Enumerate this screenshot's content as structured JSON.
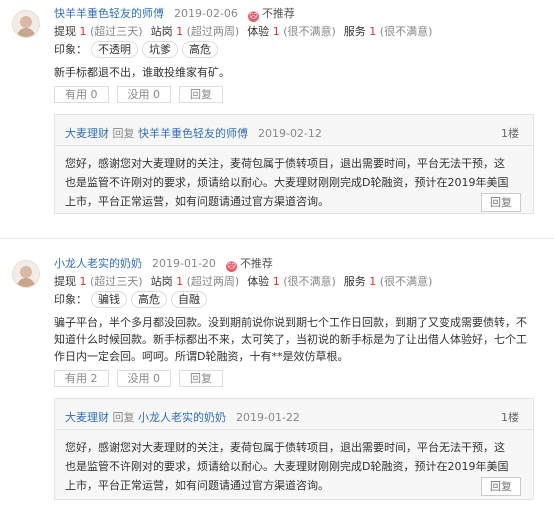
{
  "reviews": [
    {
      "username": "快羊羊重色轻友的师傅",
      "date": "2019-02-06",
      "recommend": "不推荐",
      "rec_icon": "☹",
      "ratings": [
        {
          "label": "提现",
          "value": "1",
          "note": "(超过三天)"
        },
        {
          "label": "站岗",
          "value": "1",
          "note": "(超过两周)"
        },
        {
          "label": "体验",
          "value": "1",
          "note": "(很不满意)"
        },
        {
          "label": "服务",
          "value": "1",
          "note": "(很不满意)"
        }
      ],
      "impression_label": "印象：",
      "tags": [
        "不透明",
        "坑爹",
        "高危"
      ],
      "content": "新手标都退不出，谁敢投维家有矿。",
      "useful": "有用 0",
      "useless": "没用 0",
      "reply": "回复",
      "official_reply": {
        "author": "大麦理财",
        "reply_word": "回复",
        "reply_to": "快羊羊重色轻友的师傅",
        "date": "2019-02-12",
        "floor": "1楼",
        "text": "您好，感谢您对大麦理财的关注，麦荷包属于债转项目，退出需要时间，平台无法干预，这也是监管不许刚对的要求，烦请给以耐心。大麦理财刚刚完成D轮融资，预计在2019年美国上市，平台正常运营，如有问题请通过官方渠道咨询。",
        "reply_button": "回复"
      }
    },
    {
      "username": "小龙人老实的奶奶",
      "date": "2019-01-20",
      "recommend": "不推荐",
      "rec_icon": "☹",
      "ratings": [
        {
          "label": "提现",
          "value": "1",
          "note": "(超过三天)"
        },
        {
          "label": "站岗",
          "value": "1",
          "note": "(超过两周)"
        },
        {
          "label": "体验",
          "value": "1",
          "note": "(很不满意)"
        },
        {
          "label": "服务",
          "value": "1",
          "note": "(很不满意)"
        }
      ],
      "impression_label": "印象：",
      "tags": [
        "骗钱",
        "高危",
        "自融"
      ],
      "content": "骗子平台，半个多月都没回款。没到期前说你说到期七个工作日回款，到期了又变成需要债转，不知道什么时候回款。新手标都出不来，太可笑了，当初说的新手标是为了让出借人体验好，七个工作日内一定会回。呵呵。所谓D轮融资，十有**是效仿草根。",
      "useful": "有用 2",
      "useless": "没用 0",
      "reply": "回复",
      "official_reply": {
        "author": "大麦理财",
        "reply_word": "回复",
        "reply_to": "小龙人老实的奶奶",
        "date": "2019-01-22",
        "floor": "1楼",
        "text": "您好，感谢您对大麦理财的关注，麦荷包属于债转项目，退出需要时间，平台无法干预，这也是监管不许刚对的要求，烦请给以耐心。大麦理财刚刚完成D轮融资，预计在2019年美国上市，平台正常运营，如有问题请通过官方渠道咨询。",
        "reply_button": "回复"
      }
    }
  ]
}
